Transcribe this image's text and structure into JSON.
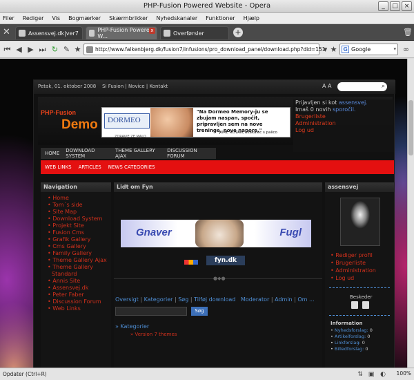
{
  "window": {
    "title": "PHP-Fusion Powered Website - Opera"
  },
  "menubar": {
    "items": [
      "Filer",
      "Rediger",
      "Vis",
      "Bogmærker",
      "Skærmbrikker",
      "Nyhedskanaler",
      "Funktioner",
      "Hjælp"
    ]
  },
  "tabs": [
    {
      "label": "Assensvej.dk|ver7"
    },
    {
      "label": "PHP-Fusion Powered W..."
    },
    {
      "label": "Overførsler"
    }
  ],
  "address": {
    "url": "http://www.falkenbjerg.dk/fusion7/infusions/pro_download_panel/download.php?did=151"
  },
  "search": {
    "engine_letter": "G",
    "value": "Google"
  },
  "site": {
    "topstrip": {
      "date": "Petak, 01. oktober 2008",
      "links": "Si Fusion | Novice | Kontakt",
      "size_toggle": "A A"
    },
    "logo": {
      "line1": "PHP-Fusion",
      "line2": "Demo"
    },
    "banner": {
      "brand": "DORMEO",
      "brand_tagline": "ZDRAVJE ZE MALO",
      "quote": "\"Na Dormeo Memory-ju se zbujam naspan, spočit, pripravljen sem na nove treninge, nove napore.\"",
      "signature": "JURE ROVAN, skakalec s palico"
    },
    "userbox": {
      "line1_prefix": "Prijavljen si kot",
      "username": "assensvej.",
      "line2_prefix": "Imaš 0 novih",
      "messages_link": "sporočil.",
      "links": [
        "Brugerliste",
        "Administration",
        "Log ud"
      ]
    },
    "menu1": [
      "HOME",
      "DOWNLOAD SYSTEM",
      "THEME GALLERY AJAX",
      "DISCUSSION FORUM"
    ],
    "menu2": [
      "WEB LINKS",
      "ARTICLES",
      "NEWS CATEGORIES"
    ],
    "navigation": {
      "title": "Navigation",
      "items": [
        "Home",
        "Tom´s side",
        "Site Map",
        "Download System",
        "Projekt Site",
        "Fusion Cms",
        "Grafik Gallery",
        "Cms Gallery",
        "Family Gallery",
        "Theme Gallery Ajax",
        "Theme Gallery Standard",
        "Annis Site",
        "Assensvej.dk",
        "Peter Faber",
        "Discussion Forum",
        "Web Links"
      ]
    },
    "main": {
      "title": "Lidt om Fyn",
      "image_text_left": "Gnaver",
      "image_text_right": "Fugl",
      "fyn_logo": "fyn.dk",
      "links": [
        "Oversigt",
        "Kategorier",
        "Søg",
        "Tilføj download",
        "Moderator",
        "Admin",
        "Om ..."
      ],
      "search_button": "Søg",
      "categories_label": "» Kategorier",
      "category_item": "» Version 7 themes"
    },
    "userpanel": {
      "title": "assensvej",
      "links": [
        "Rediger profil",
        "Brugerliste",
        "Administration",
        "Log ud"
      ],
      "messages_label": "Beskeder",
      "info_title": "Information",
      "info": [
        {
          "label": "Nyhedsforslag:",
          "value": "0"
        },
        {
          "label": "Artikelforslag:",
          "value": "0"
        },
        {
          "label": "Linkforslag:",
          "value": "0"
        },
        {
          "label": "Billedforslag:",
          "value": "0"
        }
      ]
    }
  },
  "statusbar": {
    "text": "Opdater (Ctrl+R)",
    "zoom": "100%"
  }
}
